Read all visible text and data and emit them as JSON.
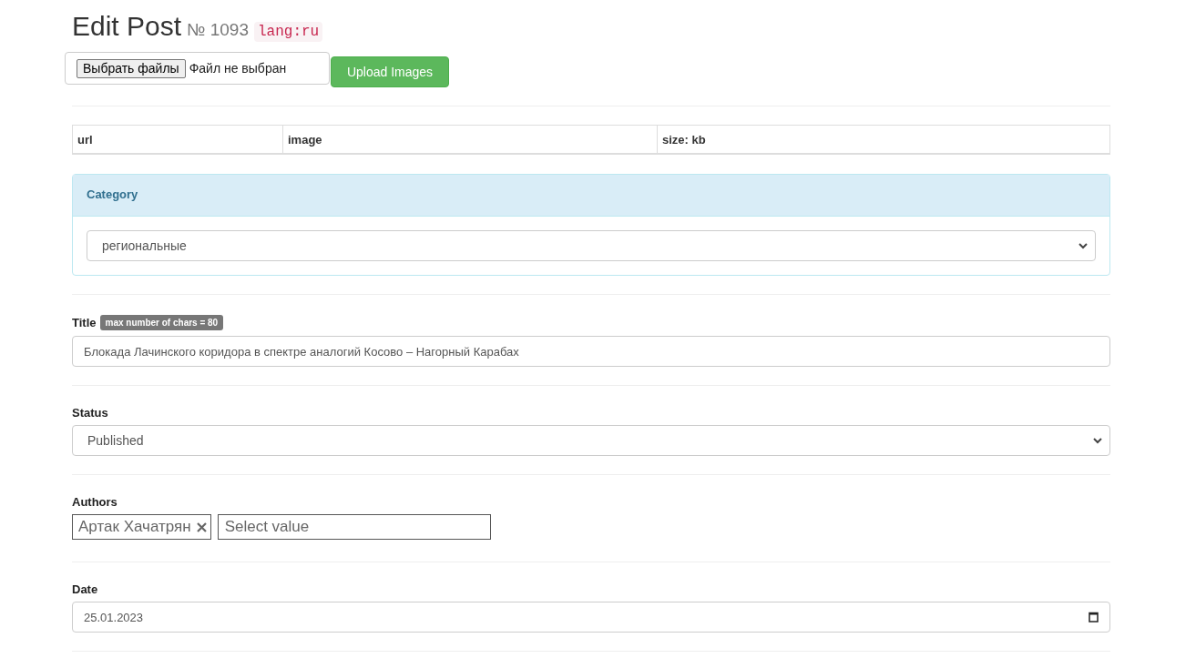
{
  "header": {
    "title": "Edit Post",
    "number": "№ 1093",
    "lang": "lang:ru"
  },
  "upload": {
    "choose_button": "Выбрать файлы",
    "file_status": "Файл не выбран",
    "upload_button": "Upload Images"
  },
  "images_table": {
    "columns": [
      "url",
      "image",
      "size: kb"
    ]
  },
  "category": {
    "heading": "Category",
    "value": "региональные"
  },
  "title_field": {
    "label": "Title",
    "badge": "max number of chars = 80",
    "value": "Блокада Лачинского коридора в спектре аналогий Косово – Нагорный Карабах"
  },
  "status_field": {
    "label": "Status",
    "value": "Published"
  },
  "authors_field": {
    "label": "Authors",
    "tags": [
      "Артак Хачатрян"
    ],
    "placeholder": "Select value"
  },
  "date_field": {
    "label": "Date",
    "value": "25.01.2023"
  }
}
